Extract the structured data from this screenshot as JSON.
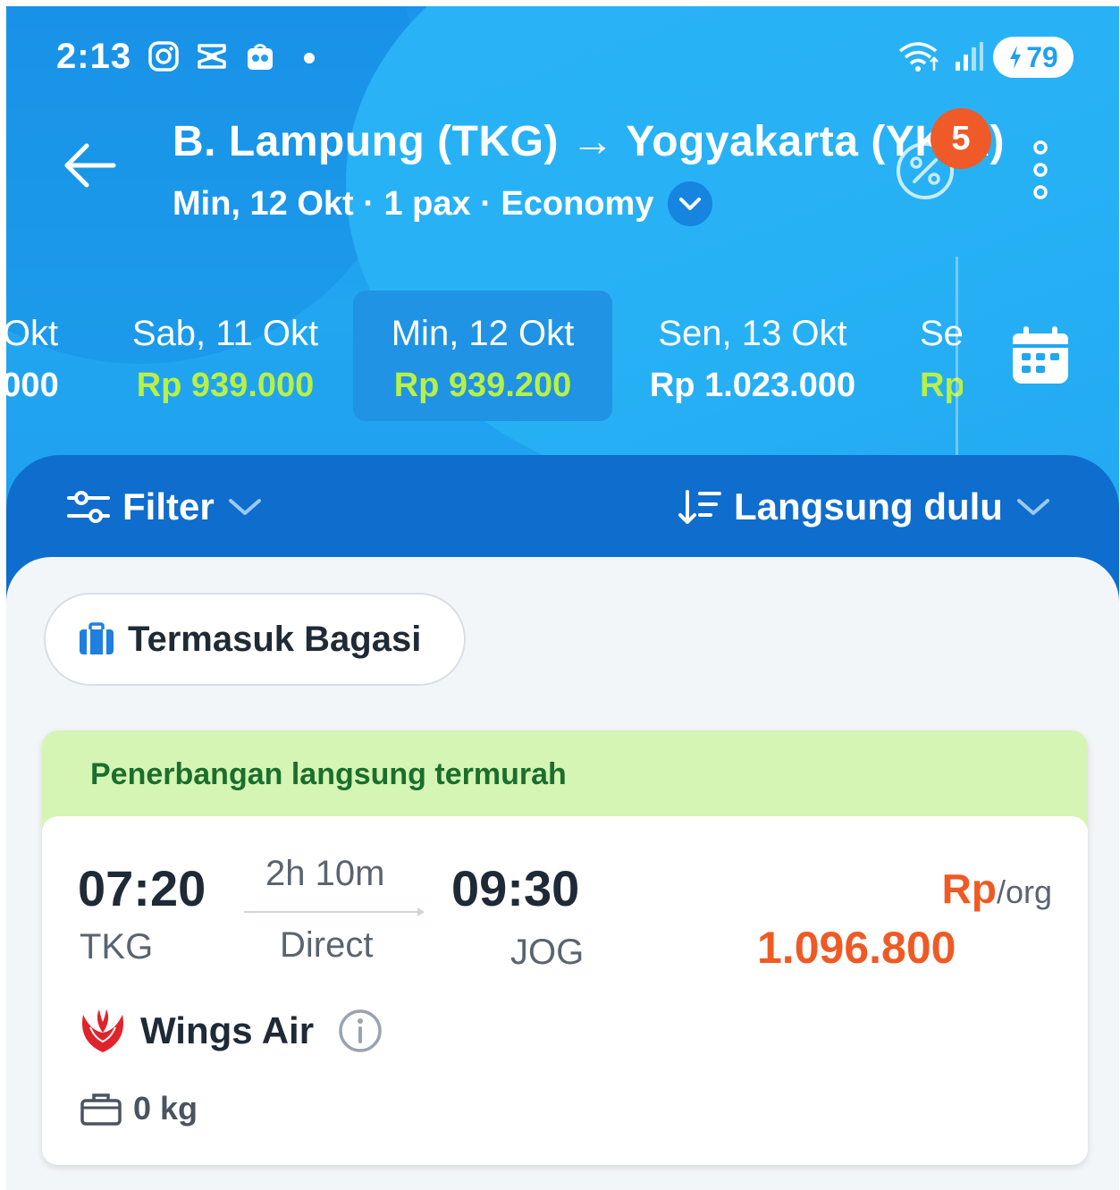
{
  "status_bar": {
    "time": "2:13",
    "battery": "79",
    "icons": [
      "instagram-icon",
      "capcut-icon",
      "app-icon",
      "wifi-icon",
      "signal-icon"
    ]
  },
  "header": {
    "route": "B. Lampung (TKG) → Yogyakarta (YKIA)",
    "subtitle": "Min, 12 Okt · 1 pax · Economy",
    "promo_badge": "5"
  },
  "dates": [
    {
      "day": "Okt",
      "price": "000",
      "tone": "white"
    },
    {
      "day": "Sab, 11 Okt",
      "price": "Rp 939.000",
      "tone": "green"
    },
    {
      "day": "Min, 12 Okt",
      "price": "Rp 939.200",
      "tone": "green",
      "active": true
    },
    {
      "day": "Sen, 13 Okt",
      "price": "Rp 1.023.000",
      "tone": "white"
    },
    {
      "day": "Se",
      "price": "Rp",
      "tone": "green"
    }
  ],
  "toolbar": {
    "filter_label": "Filter",
    "sort_label": "Langsung dulu"
  },
  "chips": {
    "baggage_label": "Termasuk Bagasi"
  },
  "flight": {
    "banner": "Penerbangan langsung termurah",
    "departure_time": "07:20",
    "arrival_time": "09:30",
    "duration": "2h 10m",
    "type": "Direct",
    "origin": "TKG",
    "destination": "JOG",
    "currency": "Rp",
    "per": "/org",
    "price": "1.096.800",
    "airline": "Wings Air",
    "baggage": "0 kg"
  },
  "colors": {
    "brand_blue": "#1e9ff0",
    "filter_bar": "#0e6dcd",
    "price_orange": "#ef5a24",
    "cheap_green": "#b8f045",
    "banner_green": "#d5f5b4",
    "badge_red": "#f05a28"
  }
}
